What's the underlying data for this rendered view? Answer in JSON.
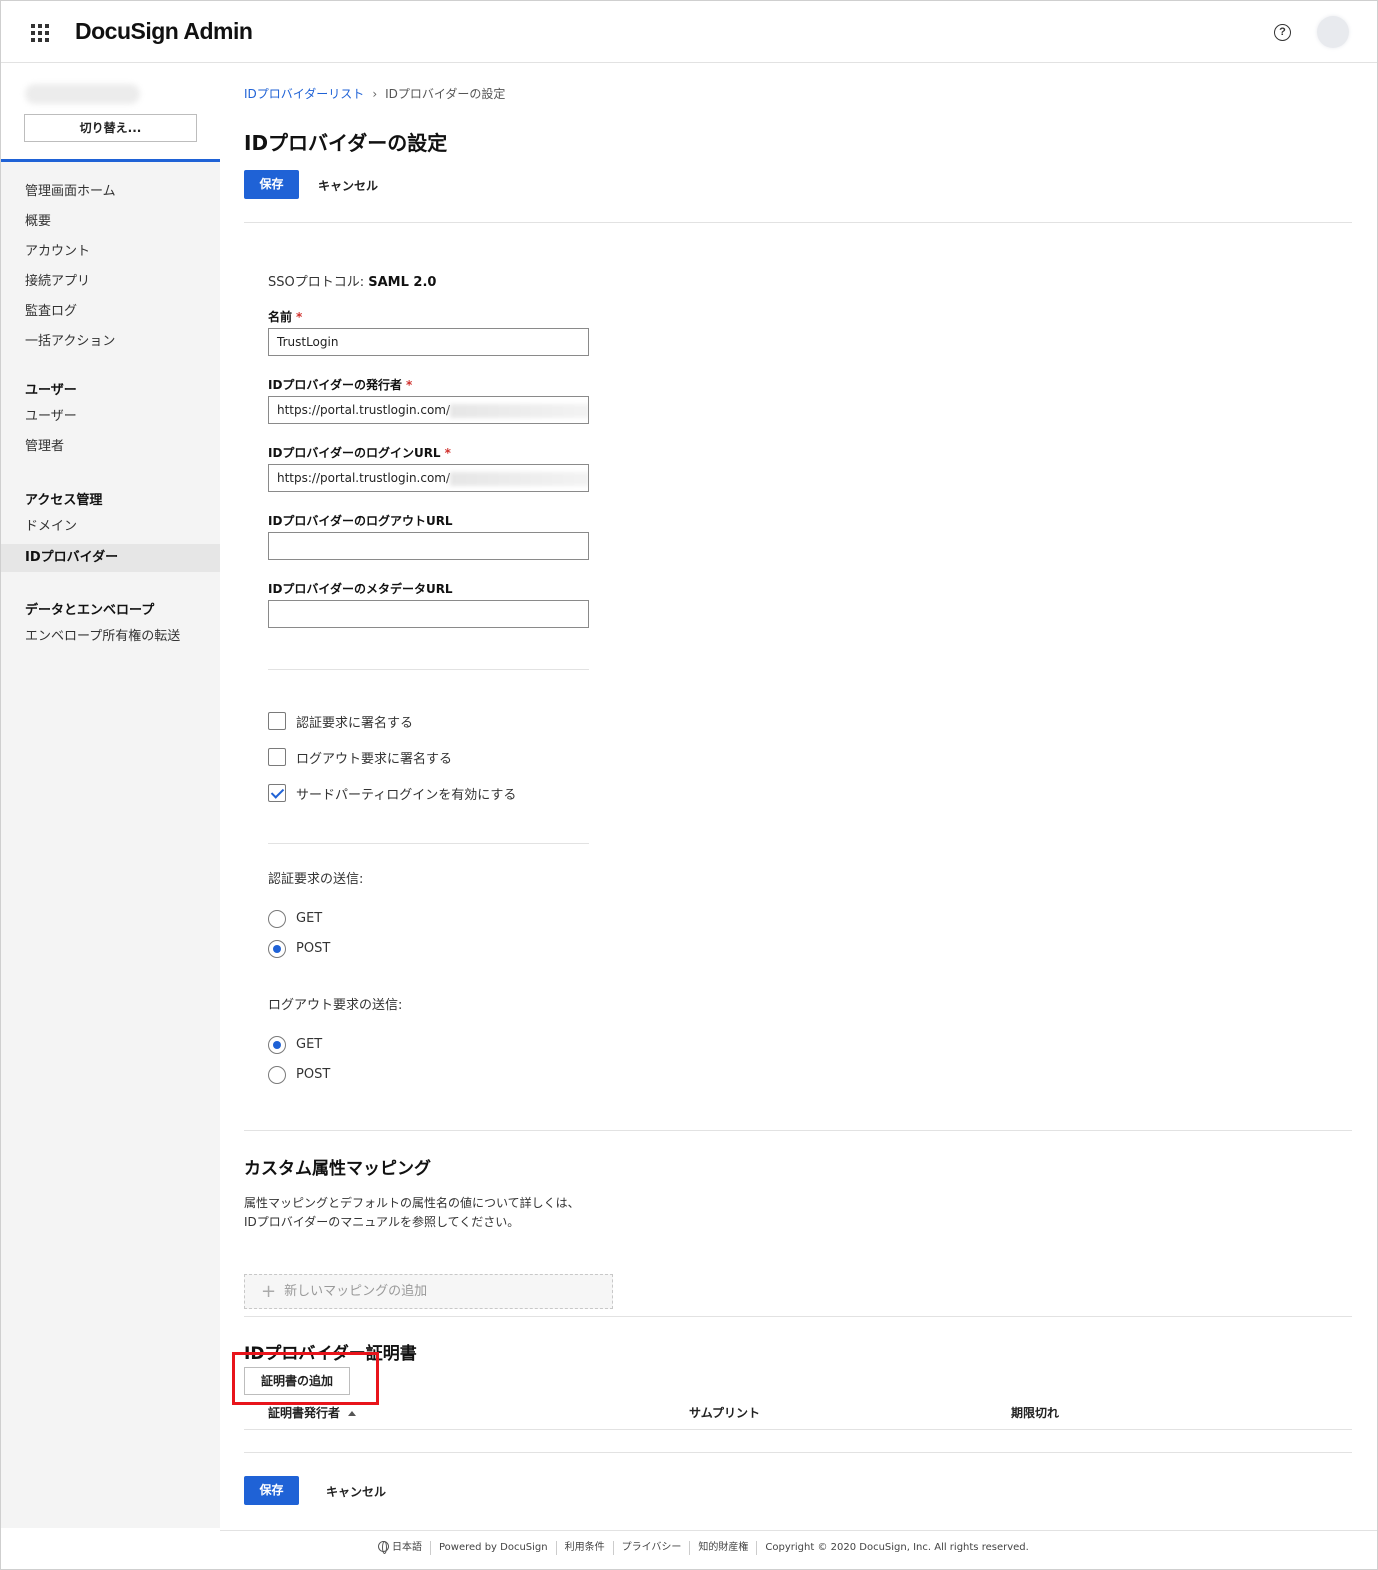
{
  "header": {
    "brand": "DocuSign Admin",
    "help_icon": "question-circle-icon",
    "apps_icon": "grid-icon"
  },
  "sidebar": {
    "switch_label": "切り替え...",
    "items_top": [
      "管理画面ホーム",
      "概要",
      "アカウント",
      "接続アプリ",
      "監査ログ",
      "一括アクション"
    ],
    "section_users": "ユーザー",
    "items_users": [
      "ユーザー",
      "管理者"
    ],
    "section_access": "アクセス管理",
    "items_access": [
      "ドメイン",
      "IDプロバイダー"
    ],
    "section_data": "データとエンベロープ",
    "items_data": [
      "エンベロープ所有権の転送"
    ]
  },
  "breadcrumb": {
    "parent": "IDプロバイダーリスト",
    "separator": "›",
    "current": "IDプロバイダーの設定"
  },
  "page": {
    "title": "IDプロバイダーの設定",
    "save": "保存",
    "cancel": "キャンセル"
  },
  "form": {
    "protocol_label": "SSOプロトコル: ",
    "protocol_value": "SAML 2.0",
    "required_mark": "*",
    "name_label": "名前",
    "name_value": "TrustLogin",
    "issuer_label": "IDプロバイダーの発行者",
    "issuer_value": "https://portal.trustlogin.com/",
    "login_url_label": "IDプロバイダーのログインURL",
    "login_url_value": "https://portal.trustlogin.com/",
    "logout_url_label": "IDプロバイダーのログアウトURL",
    "logout_url_value": "",
    "metadata_url_label": "IDプロバイダーのメタデータURL",
    "metadata_url_value": "",
    "checkboxes": [
      {
        "label": "認証要求に署名する",
        "checked": false
      },
      {
        "label": "ログアウト要求に署名する",
        "checked": false
      },
      {
        "label": "サードパーティログインを有効にする",
        "checked": true
      }
    ],
    "auth_send_label": "認証要求の送信:",
    "auth_send_options": [
      "GET",
      "POST"
    ],
    "auth_send_selected": "POST",
    "logout_send_label": "ログアウト要求の送信:",
    "logout_send_options": [
      "GET",
      "POST"
    ],
    "logout_send_selected": "GET"
  },
  "mapping": {
    "title": "カスタム属性マッピング",
    "desc_line1": "属性マッピングとデフォルトの属性名の値について詳しくは、",
    "desc_line2": "IDプロバイダーのマニュアルを参照してください。",
    "add_label": "新しいマッピングの追加"
  },
  "certificates": {
    "title": "IDプロバイダー証明書",
    "add_button": "証明書の追加",
    "columns": [
      "証明書発行者",
      "サムプリント",
      "期限切れ"
    ]
  },
  "footer": {
    "language": "日本語",
    "powered": "Powered by DocuSign",
    "terms": "利用条件",
    "privacy": "プライバシー",
    "ip": "知的財産権",
    "copyright": "Copyright © 2020 DocuSign, Inc. All rights reserved."
  },
  "colors": {
    "accent": "#1f62d6",
    "highlight": "#e8141b"
  }
}
